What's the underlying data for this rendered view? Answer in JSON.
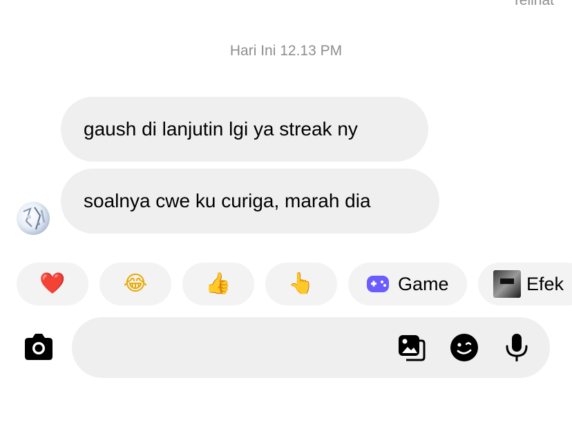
{
  "header": {
    "seen_status": "Telihat"
  },
  "conversation": {
    "timestamp": "Hari Ini 12.13 PM",
    "messages": [
      {
        "text": "gaush di lanjutin lgi ya streak ny"
      },
      {
        "text": "soalnya cwe ku curiga, marah dia"
      }
    ]
  },
  "quick_reactions": [
    {
      "emoji": "❤️",
      "icon": "red-heart-emoji"
    },
    {
      "emoji": "😂",
      "icon": "laughing-tears-emoji"
    },
    {
      "emoji": "👍",
      "icon": "thumbs-up-emoji"
    },
    {
      "emoji": "👆",
      "icon": "pointing-up-emoji"
    }
  ],
  "feature_chips": [
    {
      "label": "Game",
      "icon": "game-controller-icon",
      "color": "#6b5cff"
    },
    {
      "label": "Efek",
      "icon": "effect-thumbnail"
    }
  ],
  "composer": {
    "placeholder": "",
    "value": ""
  },
  "colors": {
    "bubble_bg": "#efefef",
    "chip_bg": "#f3f3f3",
    "meta_text": "#8e8e8e",
    "accent": "#6b5cff"
  }
}
